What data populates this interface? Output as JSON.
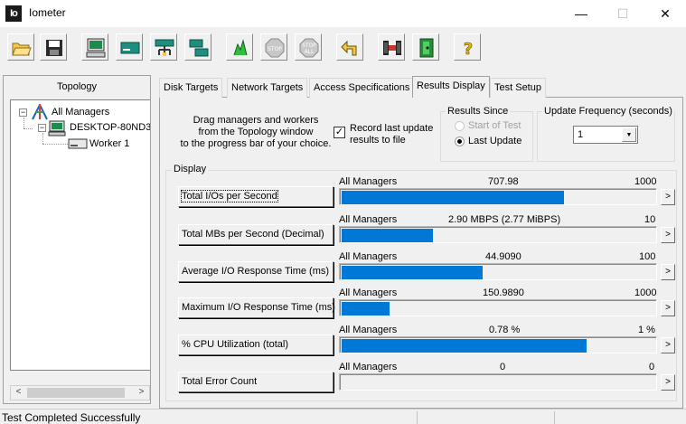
{
  "window": {
    "title": "Iometer",
    "app_icon_text": "Io",
    "minimize": "—",
    "maximize": "☐",
    "close": "✕"
  },
  "toolbar": {
    "buttons": [
      "open-icon",
      "save-icon",
      "new-manager-icon",
      "new-disk-worker-icon",
      "new-network-worker-icon",
      "duplicate-worker-icon",
      "start-tests-icon",
      "stop-icon",
      "stop-all-icon",
      "reset-workers-icon",
      "exit-icon",
      "disconnect-icon",
      "about-icon"
    ],
    "stop_label": "STOP",
    "stop_all_label": "STOP",
    "stop_all_sub": "ALL"
  },
  "topology": {
    "title": "Topology",
    "items": [
      {
        "label": "All Managers",
        "expander": "−"
      },
      {
        "label": "DESKTOP-80ND3",
        "expander": "−"
      },
      {
        "label": "Worker 1"
      }
    ],
    "scroll_left": "<",
    "scroll_right": ">"
  },
  "tabs": [
    {
      "label": "Disk Targets"
    },
    {
      "label": "Network Targets"
    },
    {
      "label": "Access Specifications"
    },
    {
      "label": "Results Display",
      "active": true
    },
    {
      "label": "Test Setup"
    }
  ],
  "instructions": {
    "line1": "Drag managers and workers",
    "line2": "from the Topology window",
    "line3": "to the progress bar of your choice."
  },
  "record": {
    "checked": true,
    "check_glyph": "✓",
    "line1": "Record last update",
    "line2": "results to file"
  },
  "results_since": {
    "title": "Results Since",
    "option_start": "Start of Test",
    "option_last": "Last Update",
    "selected": "Last Update"
  },
  "update_frequency": {
    "title": "Update Frequency (seconds)",
    "value": "1",
    "arrow": "▼"
  },
  "display": {
    "title": "Display",
    "arrow": ">",
    "rows": [
      {
        "button": "Total I/Os per Second",
        "source": "All Managers",
        "value": "707.98",
        "max": "1000",
        "fraction": 0.70798
      },
      {
        "button": "Total MBs per Second (Decimal)",
        "source": "All Managers",
        "value": "2.90 MBPS (2.77 MiBPS)",
        "max": "10",
        "fraction": 0.29
      },
      {
        "button": "Average I/O Response Time (ms)",
        "source": "All Managers",
        "value": "44.9090",
        "max": "100",
        "fraction": 0.449
      },
      {
        "button": "Maximum I/O Response Time (ms)",
        "source": "All Managers",
        "value": "150.9890",
        "max": "1000",
        "fraction": 0.151
      },
      {
        "button": "% CPU Utilization (total)",
        "source": "All Managers",
        "value": "0.78 %",
        "max": "1 %",
        "fraction": 0.78
      },
      {
        "button": "Total Error Count",
        "source": "All Managers",
        "value": "0",
        "max": "0",
        "fraction": 0
      }
    ]
  },
  "status": {
    "text": "Test Completed Successfully"
  }
}
